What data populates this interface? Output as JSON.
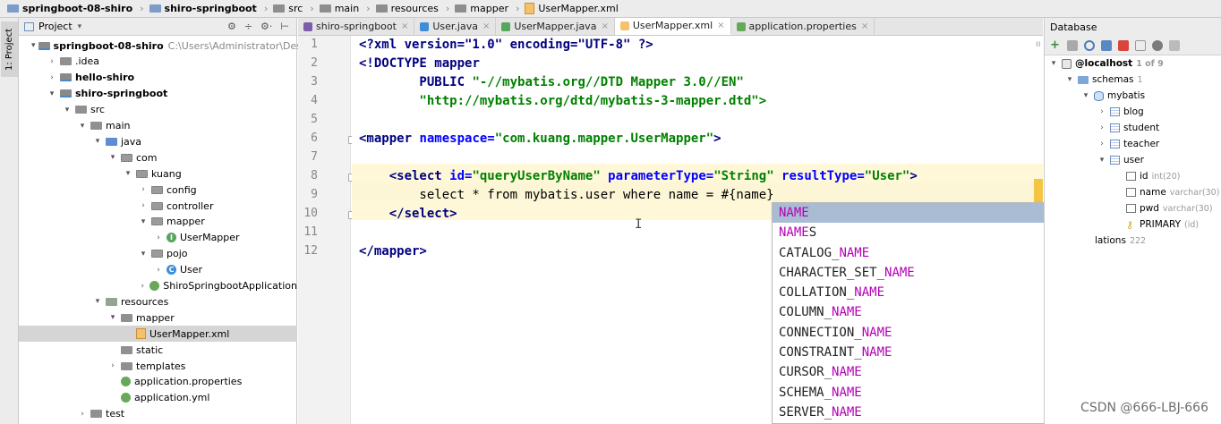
{
  "breadcrumb": [
    "springboot-08-shiro",
    "shiro-springboot",
    "src",
    "main",
    "resources",
    "mapper",
    "UserMapper.xml"
  ],
  "left_stripe": {
    "project_tab": "1: Project"
  },
  "project_panel": {
    "title": "Project",
    "dropdown": "▾",
    "icons": [
      "⚙",
      "÷",
      "⚙·",
      "⊢"
    ],
    "tree": [
      {
        "label": "springboot-08-shiro",
        "path": "C:\\Users\\Administrator\\Desktop\\S",
        "bold": true,
        "arrow": "▾",
        "icon": "module",
        "depth": 0
      },
      {
        "label": ".idea",
        "arrow": "›",
        "icon": "folder",
        "depth": 1
      },
      {
        "label": "hello-shiro",
        "bold": true,
        "arrow": "›",
        "icon": "module",
        "depth": 1
      },
      {
        "label": "shiro-springboot",
        "bold": true,
        "arrow": "▾",
        "icon": "module",
        "depth": 1
      },
      {
        "label": "src",
        "arrow": "▾",
        "icon": "folder",
        "depth": 2
      },
      {
        "label": "main",
        "arrow": "▾",
        "icon": "folder",
        "depth": 3
      },
      {
        "label": "java",
        "arrow": "▾",
        "icon": "src",
        "depth": 4
      },
      {
        "label": "com",
        "arrow": "▾",
        "icon": "pkg",
        "depth": 5
      },
      {
        "label": "kuang",
        "arrow": "▾",
        "icon": "pkg",
        "depth": 6
      },
      {
        "label": "config",
        "arrow": "›",
        "icon": "pkg",
        "depth": 7
      },
      {
        "label": "controller",
        "arrow": "›",
        "icon": "pkg",
        "depth": 7
      },
      {
        "label": "mapper",
        "arrow": "▾",
        "icon": "pkg",
        "depth": 7
      },
      {
        "label": "UserMapper",
        "arrow": "›",
        "icon": "iface",
        "depth": 8
      },
      {
        "label": "pojo",
        "arrow": "▾",
        "icon": "pkg",
        "depth": 7
      },
      {
        "label": "User",
        "arrow": "›",
        "icon": "class",
        "depth": 8
      },
      {
        "label": "ShiroSpringbootApplication",
        "arrow": "›",
        "icon": "spring",
        "depth": 7
      },
      {
        "label": "resources",
        "arrow": "▾",
        "icon": "res",
        "depth": 4
      },
      {
        "label": "mapper",
        "arrow": "▾",
        "icon": "folder",
        "depth": 5
      },
      {
        "label": "UserMapper.xml",
        "arrow": "",
        "icon": "xml",
        "depth": 6,
        "selected": true
      },
      {
        "label": "static",
        "arrow": "",
        "icon": "folder",
        "depth": 5
      },
      {
        "label": "templates",
        "arrow": "›",
        "icon": "folder",
        "depth": 5
      },
      {
        "label": "application.properties",
        "arrow": "",
        "icon": "spring",
        "depth": 5
      },
      {
        "label": "application.yml",
        "arrow": "",
        "icon": "spring",
        "depth": 5
      },
      {
        "label": "test",
        "arrow": "›",
        "icon": "folder",
        "depth": 3
      }
    ]
  },
  "editor_tabs": [
    {
      "label": "shiro-springboot",
      "icon_color": "#7b5ea7",
      "active": false
    },
    {
      "label": "User.java",
      "icon_color": "#3d8ed8",
      "active": false
    },
    {
      "label": "UserMapper.java",
      "icon_color": "#58a55c",
      "active": false
    },
    {
      "label": "UserMapper.xml",
      "icon_color": "#f5c16c",
      "active": true
    },
    {
      "label": "application.properties",
      "icon_color": "#68a85b",
      "active": false
    }
  ],
  "tab_close": "×",
  "gutter": {
    "line_numbers": [
      "1",
      "2",
      "3",
      "4",
      "5",
      "6",
      "7",
      "8",
      "9",
      "10",
      "11",
      "12"
    ]
  },
  "code": {
    "l1": "<?xml version=\"1.0\" encoding=\"UTF-8\" ?>",
    "l2a": "<!DOCTYPE ",
    "l2b": "mapper",
    "l3a": "        PUBLIC ",
    "l3b": "\"-//mybatis.org//DTD Mapper 3.0//EN\"",
    "l4": "        \"http://mybatis.org/dtd/mybatis-3-mapper.dtd\">",
    "l6a": "<mapper ",
    "l6b": "namespace=",
    "l6c": "\"com.kuang.mapper.UserMapper\"",
    "l6d": ">",
    "l8a": "    <select ",
    "l8b": "id=",
    "l8c": "\"queryUserByName\"",
    "l8d": " parameterType=",
    "l8e": "\"String\"",
    "l8f": " resultType=",
    "l8g": "\"User\"",
    "l8h": ">",
    "l9": "        select * from mybatis.user where name = #{name}",
    "l10": "    </select>",
    "l12": "</mapper>"
  },
  "autocomplete": {
    "items": [
      {
        "pre": "",
        "match": "NAME",
        "post": ""
      },
      {
        "pre": "",
        "match": "NAME",
        "post": "S"
      },
      {
        "pre": "CATALOG_",
        "match": "NAME",
        "post": ""
      },
      {
        "pre": "CHARACTER_SET_",
        "match": "NAME",
        "post": ""
      },
      {
        "pre": "COLLATION_",
        "match": "NAME",
        "post": ""
      },
      {
        "pre": "COLUMN_",
        "match": "NAME",
        "post": ""
      },
      {
        "pre": "CONNECTION_",
        "match": "NAME",
        "post": ""
      },
      {
        "pre": "CONSTRAINT_",
        "match": "NAME",
        "post": ""
      },
      {
        "pre": "CURSOR_",
        "match": "NAME",
        "post": ""
      },
      {
        "pre": "SCHEMA_",
        "match": "NAME",
        "post": ""
      },
      {
        "pre": "SERVER_",
        "match": "NAME",
        "post": ""
      }
    ],
    "selected_index": 0
  },
  "db_panel": {
    "title": "Database",
    "tree": [
      {
        "label": "@localhost",
        "muted": "1 of 9",
        "bold": true,
        "arrow": "▾",
        "icon": "server",
        "depth": 0
      },
      {
        "label": "schemas",
        "muted": "1",
        "arrow": "▾",
        "icon": "schemas",
        "depth": 1
      },
      {
        "label": "mybatis",
        "muted": "",
        "arrow": "▾",
        "icon": "db",
        "depth": 2
      },
      {
        "label": "blog",
        "muted": "",
        "arrow": "›",
        "icon": "table",
        "depth": 3
      },
      {
        "label": "student",
        "muted": "",
        "arrow": "›",
        "icon": "table",
        "depth": 3
      },
      {
        "label": "teacher",
        "muted": "",
        "arrow": "›",
        "icon": "table",
        "depth": 3
      },
      {
        "label": "user",
        "muted": "",
        "arrow": "▾",
        "icon": "table",
        "depth": 3
      },
      {
        "label": "id",
        "muted": "int(20)",
        "arrow": "",
        "icon": "col",
        "depth": 4
      },
      {
        "label": "name",
        "muted": "varchar(30)",
        "arrow": "",
        "icon": "col",
        "depth": 4
      },
      {
        "label": "pwd",
        "muted": "varchar(30)",
        "arrow": "",
        "icon": "col",
        "depth": 4
      },
      {
        "label": "PRIMARY",
        "muted": "(id)",
        "arrow": "",
        "icon": "key",
        "depth": 4
      },
      {
        "label": "lations",
        "muted": "222",
        "arrow": "",
        "icon": "",
        "depth": 1
      }
    ]
  },
  "text_cursor": "I",
  "scroll_indicator": "ıı",
  "watermark": "CSDN @666-LBJ-666"
}
